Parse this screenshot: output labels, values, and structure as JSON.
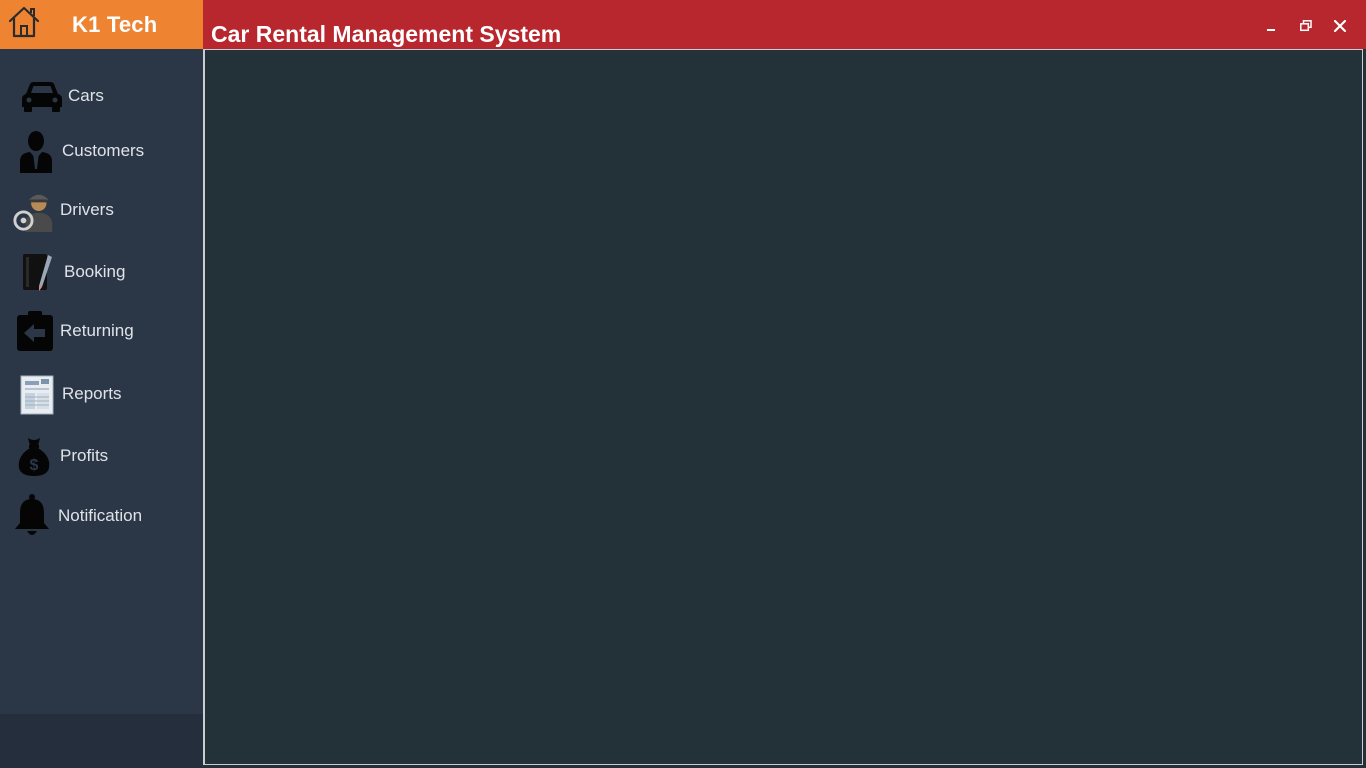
{
  "brand": {
    "title": "K1 Tech",
    "icon": "home-icon",
    "color": "#ee8432"
  },
  "titlebar": {
    "title": "Car Rental Management System",
    "color": "#b8262e",
    "controls": {
      "minimize_icon": "minimize-icon",
      "restore_icon": "restore-icon",
      "close_icon": "close-icon"
    }
  },
  "sidebar": {
    "background": "#2b3747",
    "items": [
      {
        "label": "Cars",
        "icon": "car-icon"
      },
      {
        "label": "Customers",
        "icon": "customer-icon"
      },
      {
        "label": "Drivers",
        "icon": "driver-icon"
      },
      {
        "label": "Booking",
        "icon": "booking-icon"
      },
      {
        "label": "Returning",
        "icon": "returning-icon"
      },
      {
        "label": "Reports",
        "icon": "reports-icon"
      },
      {
        "label": "Profits",
        "icon": "money-bag-icon"
      },
      {
        "label": "Notification",
        "icon": "bell-icon"
      }
    ]
  },
  "main": {
    "background": "#233239"
  }
}
